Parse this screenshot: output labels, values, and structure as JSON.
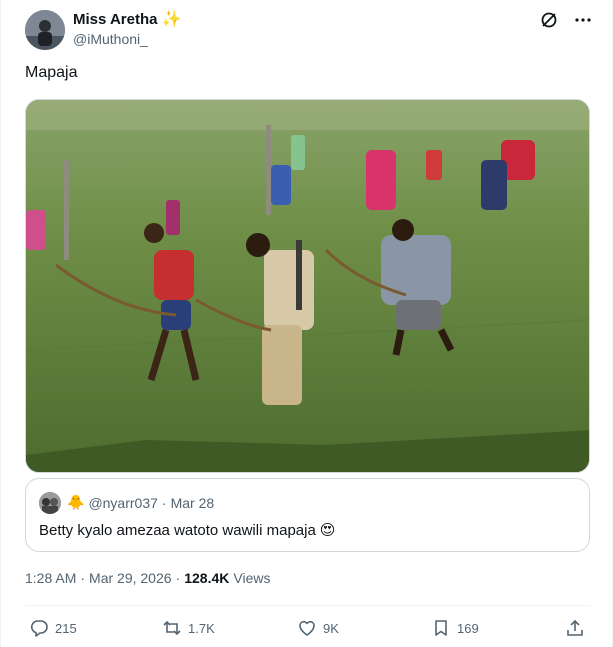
{
  "author": {
    "display_name": "Miss Aretha",
    "badge_icon": "sparkles-icon",
    "handle": "@iMuthoni_"
  },
  "header_actions": [
    {
      "icon": "grok-icon"
    },
    {
      "icon": "more-icon"
    }
  ],
  "tweet": {
    "text": "Mapaja",
    "media_icon": "photo-archers-in-field"
  },
  "quote": {
    "emoji_badge": "🐥",
    "handle": "@nyarr037",
    "separator": "·",
    "date": "Mar 28",
    "text": "Betty kyalo amezaa watoto wawili mapaja",
    "emoji": "😍"
  },
  "meta": {
    "time": "1:28 AM",
    "separator": "·",
    "date": "Mar 29, 2026",
    "separator2": "·",
    "views_count": "128.4K",
    "views_label": "Views"
  },
  "actions": {
    "replies": "215",
    "reposts": "1.7K",
    "likes": "9K",
    "bookmarks": "169"
  },
  "colors": {
    "text_primary": "#0f1419",
    "text_secondary": "#536471",
    "border": "#cfd9de",
    "sparkle": "#f5c518"
  }
}
